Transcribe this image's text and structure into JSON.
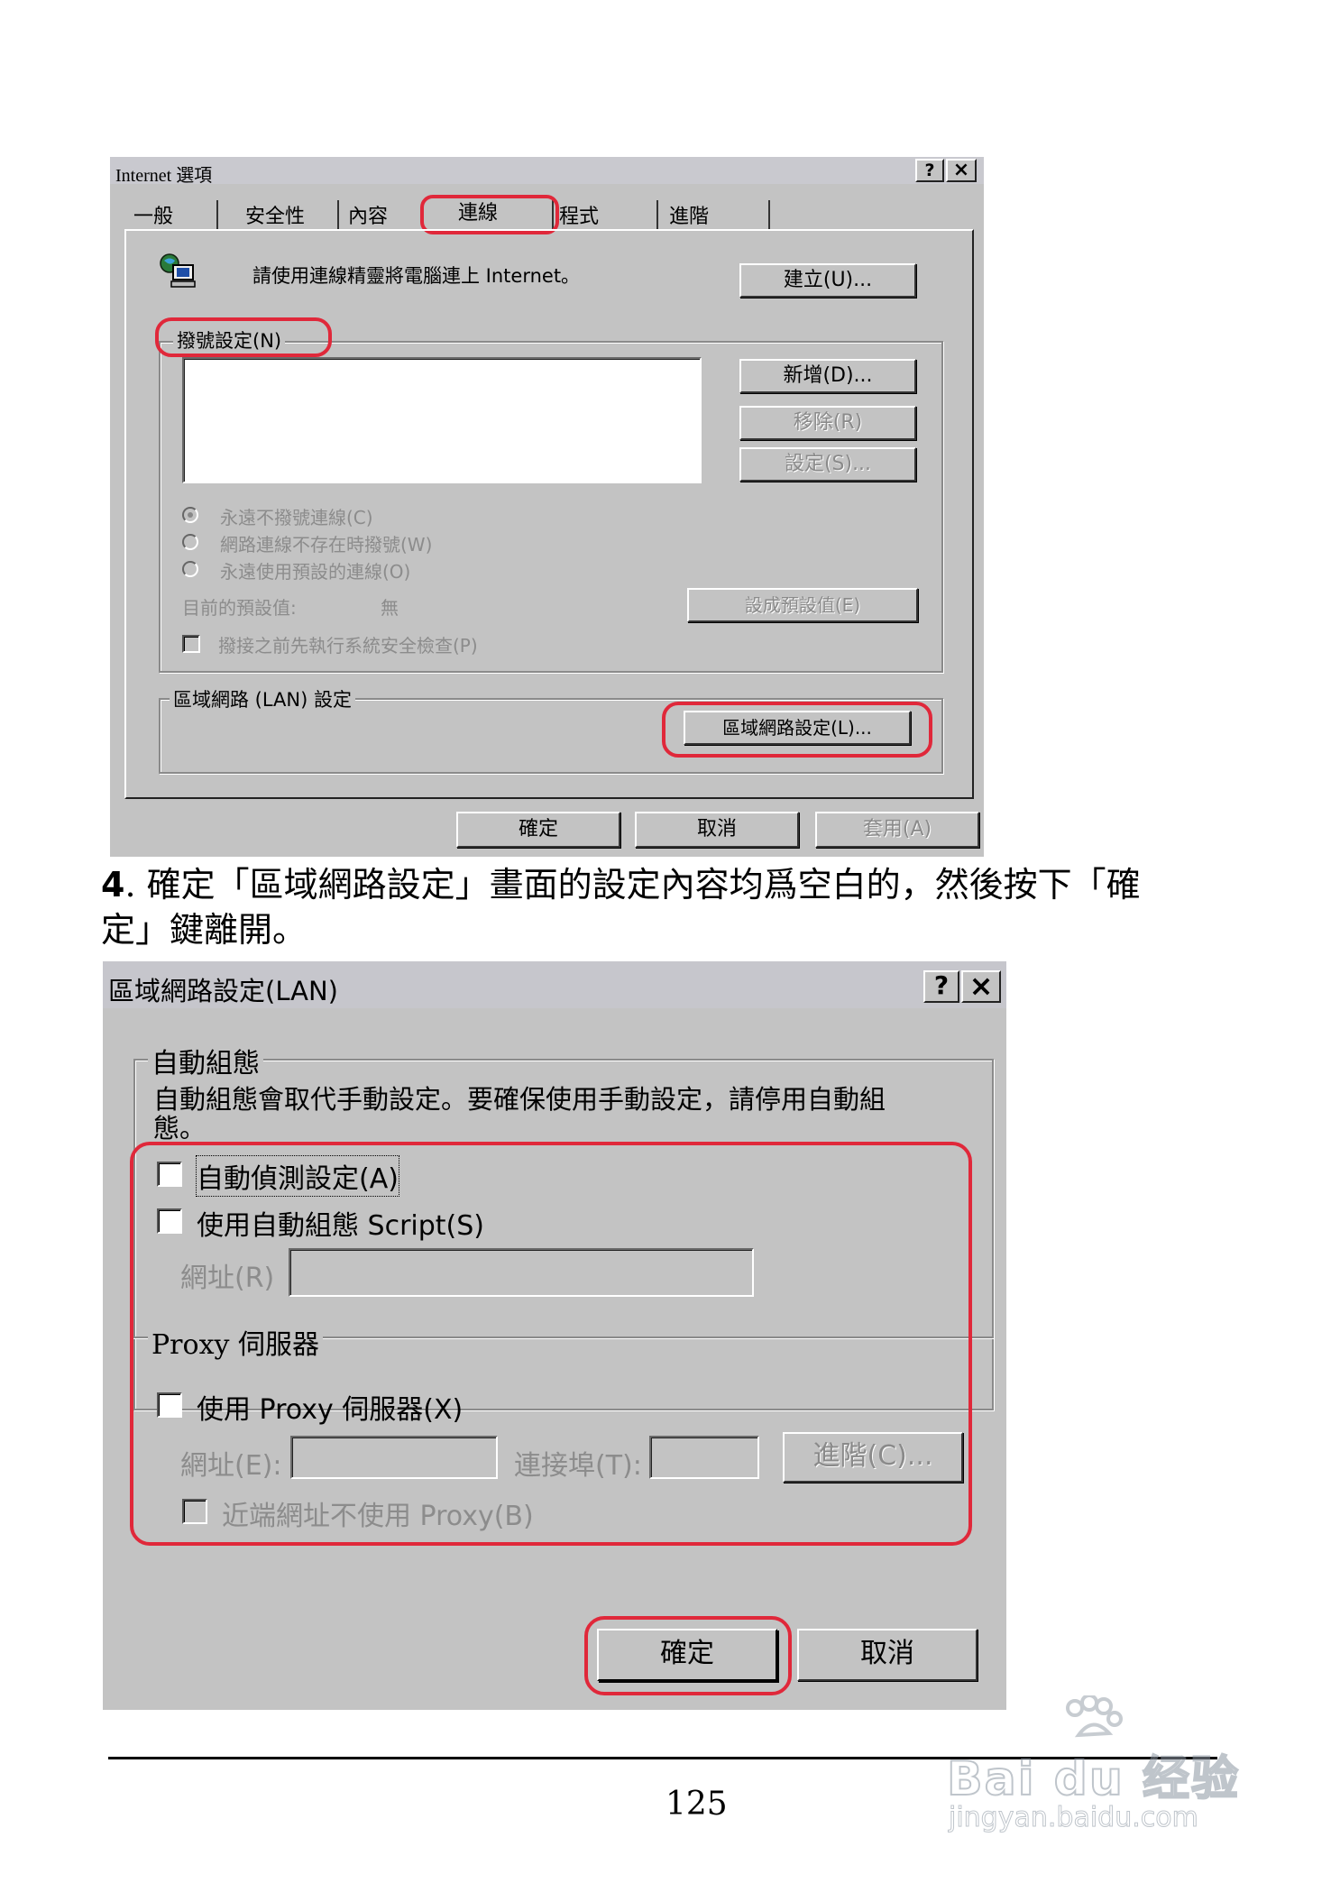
{
  "dialog1": {
    "title": "Internet 選項",
    "help_btn": "?",
    "close_btn": "×",
    "tabs": [
      "一般",
      "安全性",
      "內容",
      "連線",
      "程式",
      "進階"
    ],
    "wizard_text": "請使用連線精靈將電腦連上 Internet。",
    "setup_btn": "建立(U)...",
    "dialup_group": "撥號設定(N)",
    "add_btn": "新增(D)...",
    "remove_btn": "移除(R)",
    "settings_btn": "設定(S)...",
    "radio_never": "永遠不撥號連線(C)",
    "radio_when_needed": "網路連線不存在時撥號(W)",
    "radio_always": "永遠使用預設的連線(O)",
    "current_default_label": "目前的預設值:",
    "current_default_value": "無",
    "set_default_btn": "設成預設值(E)",
    "security_check": "撥接之前先執行系統安全檢查(P)",
    "lan_group": "區域網路 (LAN) 設定",
    "lan_btn": "區域網路設定(L)...",
    "ok_btn": "確定",
    "cancel_btn": "取消",
    "apply_btn": "套用(A)"
  },
  "instruction": {
    "number": "4",
    "line1": ". 確定「區域網路設定」畫面的設定內容均爲空白的，然後按下「確",
    "line2": "定」鍵離開。"
  },
  "dialog2": {
    "title": "區域網路設定(LAN)",
    "help_btn": "?",
    "close_btn": "×",
    "auto_group": "自動組態",
    "auto_desc_line1": "自動組態會取代手動設定。要確保使用手動設定，請停用自動組",
    "auto_desc_line2": "態。",
    "auto_detect": "自動偵測設定(A)",
    "auto_script": "使用自動組態 Script(S)",
    "address_label": "網址(R)",
    "proxy_group": "Proxy 伺服器",
    "use_proxy": "使用 Proxy 伺服器(X)",
    "proxy_address_label": "網址(E):",
    "port_label": "連接埠(T):",
    "advanced_btn": "進階(C)...",
    "bypass_local": "近端網址不使用 Proxy(B)",
    "ok_btn": "確定",
    "cancel_btn": "取消"
  },
  "page_number": "125",
  "watermark": {
    "brand": "Bai du 经验",
    "url": "jingyan.baidu.com"
  },
  "colors": {
    "dialog_bg": "#c3c3c3",
    "highlight_red": "#e0283a"
  }
}
